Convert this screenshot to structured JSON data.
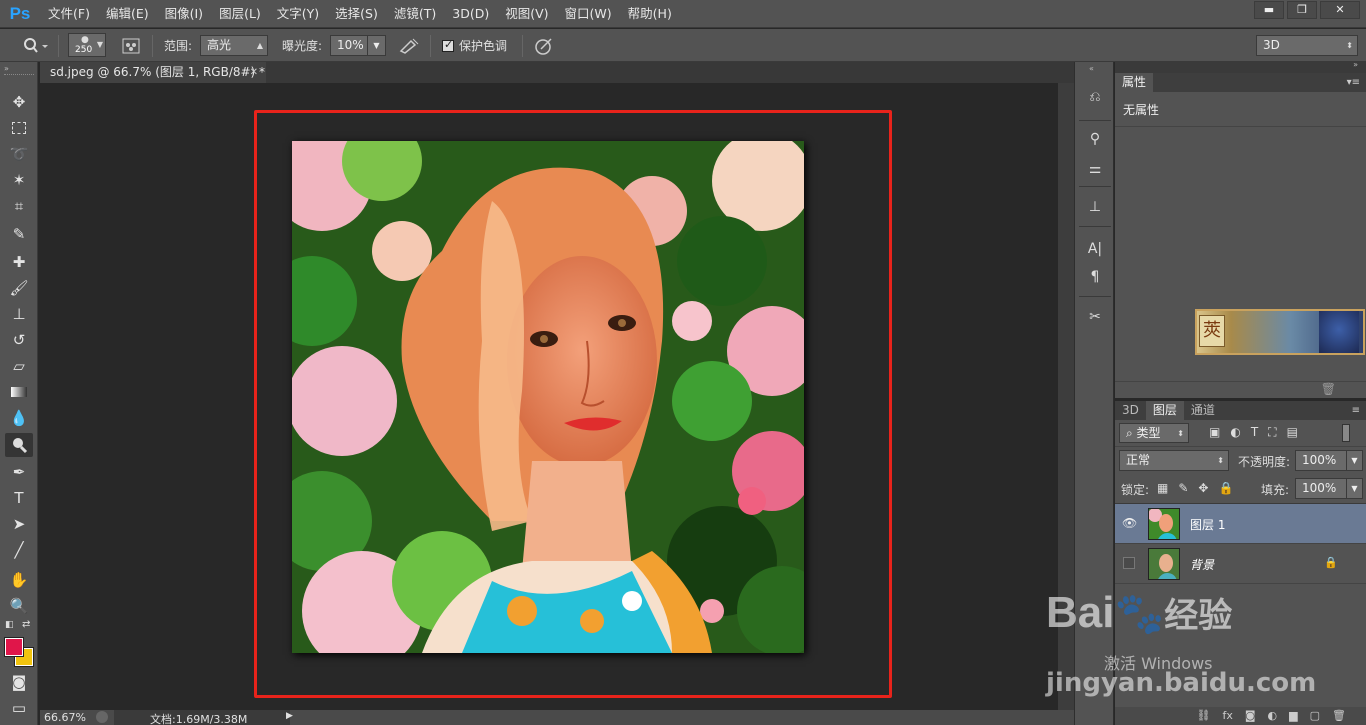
{
  "app": {
    "logo": "Ps"
  },
  "menu": [
    "文件(F)",
    "编辑(E)",
    "图像(I)",
    "图层(L)",
    "文字(Y)",
    "选择(S)",
    "滤镜(T)",
    "3D(D)",
    "视图(V)",
    "窗口(W)",
    "帮助(H)"
  ],
  "window_buttons": {
    "minimize": "▬",
    "restore": "❐",
    "close": "✕"
  },
  "options": {
    "brush_size": "250",
    "range_label": "范围:",
    "range_value": "高光",
    "exposure_label": "曝光度:",
    "exposure_value": "10%",
    "protect_tones_label": "保护色调",
    "protect_tones_checked": true,
    "workspace": "3D"
  },
  "document": {
    "tab_title": "sd.jpeg @ 66.7% (图层 1, RGB/8#) *",
    "zoom": "66.67%",
    "doc_info": "文档:1.69M/3.38M"
  },
  "properties": {
    "tab": "属性",
    "empty_text": "无属性"
  },
  "layers_panel": {
    "tabs": [
      "3D",
      "图层",
      "通道"
    ],
    "active_tab": "图层",
    "filter_kind": "类型",
    "blend_mode": "正常",
    "opacity_label": "不透明度:",
    "opacity_value": "100%",
    "lock_label": "锁定:",
    "fill_label": "填充:",
    "fill_value": "100%",
    "layers": [
      {
        "name": "图层 1",
        "visible": true,
        "selected": true
      },
      {
        "name": "背景",
        "visible": false,
        "locked": true
      }
    ]
  },
  "watermark": {
    "brand": "Bai",
    "brand_suffix": "经验",
    "activate": "激活 Windows",
    "url": "jingyan.baidu.com"
  },
  "colors": {
    "foreground": "#e0164a",
    "background": "#f1c40f",
    "highlight_box": "#e8231b",
    "ps_blue": "#29a3ff"
  }
}
